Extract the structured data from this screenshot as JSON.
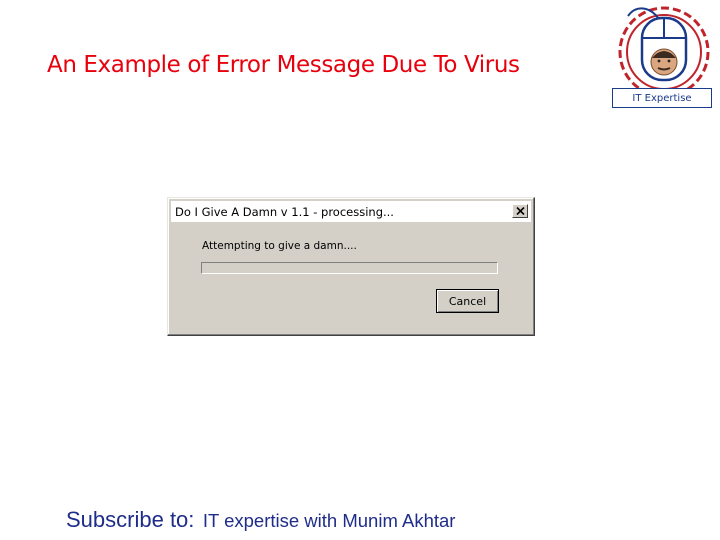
{
  "slide": {
    "title": "An Example of Error Message Due To Virus"
  },
  "logo": {
    "badge_text": "IT Expertise",
    "icon": "it-expertise-logo-icon"
  },
  "dialog": {
    "title": "Do I Give A Damn v 1.1 - processing...",
    "message": "Attempting to give a damn....",
    "progress": 0,
    "cancel_label": "Cancel",
    "close_icon": "close-icon"
  },
  "footer": {
    "label": "Subscribe to:",
    "channel": "IT expertise with Munim Akhtar"
  },
  "colors": {
    "title": "#e8000d",
    "footer": "#1f2d8a",
    "dialog_face": "#d4d0c8",
    "progress_fill": "#0a246a",
    "logo_border": "#1a3a8a"
  }
}
